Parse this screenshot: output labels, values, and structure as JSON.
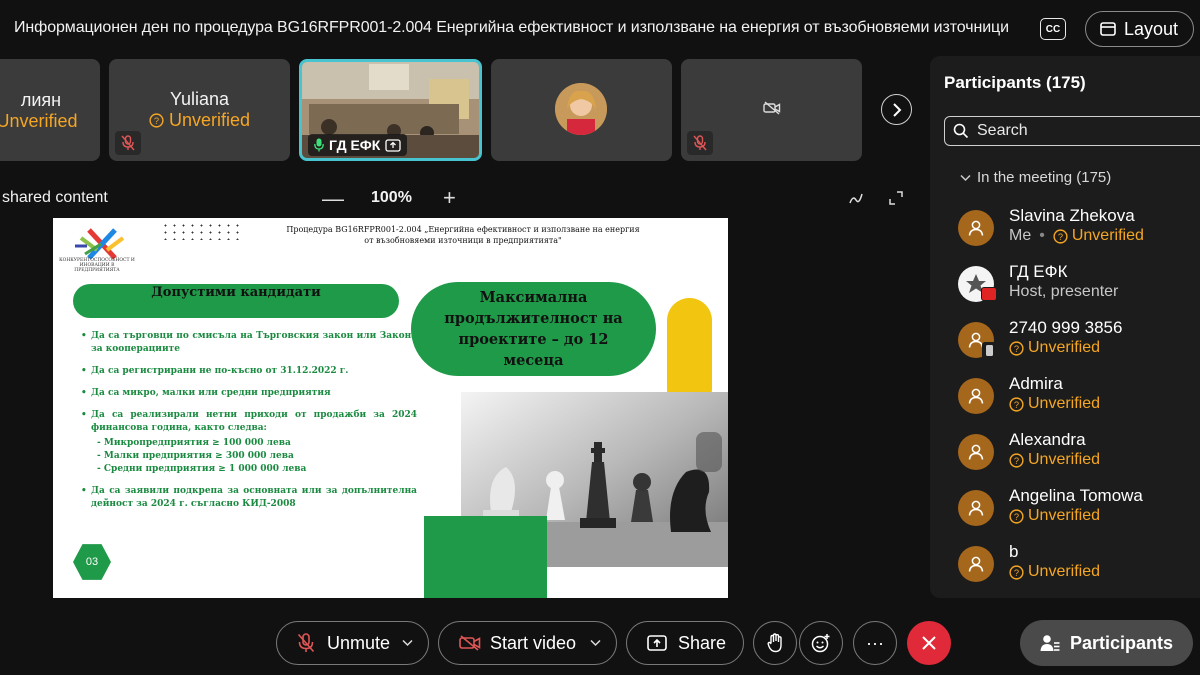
{
  "topbar": {
    "meeting_title": "Информационен ден по процедура BG16RFPR001-2.004 Енергийна ефективност и използване на енергия от възобновяеми източници",
    "cc_label": "CC",
    "layout_label": "Layout"
  },
  "video_strip": {
    "tiles": [
      {
        "name": "лиян",
        "status": "Unverified"
      },
      {
        "name": "Yuliana",
        "status": "Unverified"
      },
      {
        "name": "ГД ЕФК"
      },
      {},
      {}
    ]
  },
  "shared": {
    "label": "shared content",
    "zoom_minus": "—",
    "zoom_value": "100%",
    "zoom_plus": "+"
  },
  "slide": {
    "header_line1": "Процедура BG16RFPR001-2.004 „Енергийна ефективност и използване на енергия",
    "header_line2": "от възобновяеми източници в предприятията\"",
    "logo_caption": "КОНКУРЕНТОСПОСОБНОСТ И ИНОВАЦИИ В ПРЕДПРИЯТИЯТА",
    "section_title": "Допустими кандидати",
    "criteria": [
      "Да са търговци по смисъла на Търговския закон или Закона за кооперациите",
      "Да са регистрирани не по-късно от 31.12.2022 г.",
      "Да са микро, малки или средни предприятия",
      "Да са реализирали нетни приходи от продажби за 2024 финансова година, както следва:",
      "Да са заявили подкрепа за основната или за допълнителна дейност за 2024 г. съгласно КИД-2008"
    ],
    "sub_criteria": [
      "-  Микропредприятия ≥ 100 000 лева",
      "- Малки предприятия ≥ 300 000 лева",
      "- Средни предприятия ≥ 1 000 000 лева"
    ],
    "duration_line1": "Максимална",
    "duration_line2": "продължителност на",
    "duration_line3": "проектите – до 12 месеца",
    "page_number": "03"
  },
  "participants_panel": {
    "title": "Participants (175)",
    "search_placeholder": "Search",
    "section_label": "In the meeting (175)",
    "people": [
      {
        "name": "Slavina Zhekova",
        "role": "Me",
        "status": "Unverified"
      },
      {
        "name": "ГД ЕФК",
        "role": "Host, presenter"
      },
      {
        "name": "2740 999 3856",
        "status": "Unverified"
      },
      {
        "name": "Admira",
        "status": "Unverified"
      },
      {
        "name": "Alexandra",
        "status": "Unverified"
      },
      {
        "name": "Angelina Tomowa",
        "status": "Unverified"
      },
      {
        "name": "b",
        "status": "Unverified"
      }
    ]
  },
  "toolbar": {
    "unmute_label": "Unmute",
    "start_video_label": "Start video",
    "share_label": "Share",
    "more_label": "···",
    "participants_label": "Participants"
  },
  "colors": {
    "unverified": "#f5a623",
    "slide_green": "#1f9a48",
    "slide_yellow": "#f2c511",
    "leave_red": "#e02a3a",
    "active_tile_border": "#47c4cf"
  }
}
